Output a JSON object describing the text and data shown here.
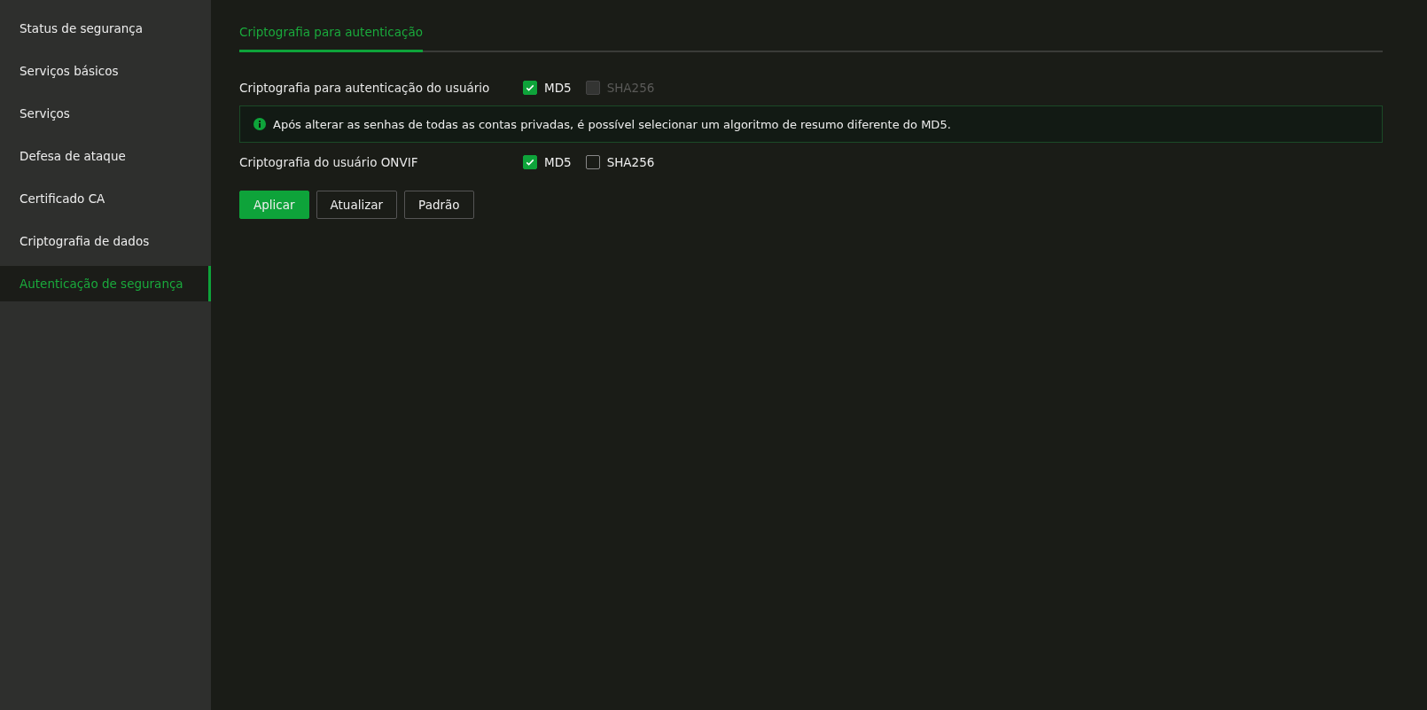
{
  "sidebar": {
    "items": [
      {
        "label": "Status de segurança",
        "selected": false
      },
      {
        "label": "Serviços básicos",
        "selected": false
      },
      {
        "label": "Serviços",
        "selected": false
      },
      {
        "label": "Defesa de ataque",
        "selected": false
      },
      {
        "label": "Certificado CA",
        "selected": false
      },
      {
        "label": "Criptografia de dados",
        "selected": false
      },
      {
        "label": "Autenticação de segurança",
        "selected": true
      }
    ]
  },
  "tabs": [
    {
      "label": "Criptografia para autenticação",
      "selected": true
    }
  ],
  "rows": [
    {
      "kind": "options",
      "label": "Criptografia para autenticação do usuário",
      "options": [
        {
          "label": "MD5",
          "checked": true,
          "disabled": false
        },
        {
          "label": "SHA256",
          "checked": false,
          "disabled": true
        }
      ]
    },
    {
      "kind": "notice",
      "text": "Após alterar as senhas de todas as contas privadas, é possível selecionar um algoritmo de resumo diferente do MD5."
    },
    {
      "kind": "options",
      "label": "Criptografia do usuário ONVIF",
      "options": [
        {
          "label": "MD5",
          "checked": true,
          "disabled": false
        },
        {
          "label": "SHA256",
          "checked": false,
          "disabled": false
        }
      ]
    }
  ],
  "buttons": [
    {
      "label": "Aplicar",
      "kind": "primary"
    },
    {
      "label": "Atualizar",
      "kind": "secondary"
    },
    {
      "label": "Padrão",
      "kind": "secondary"
    }
  ]
}
